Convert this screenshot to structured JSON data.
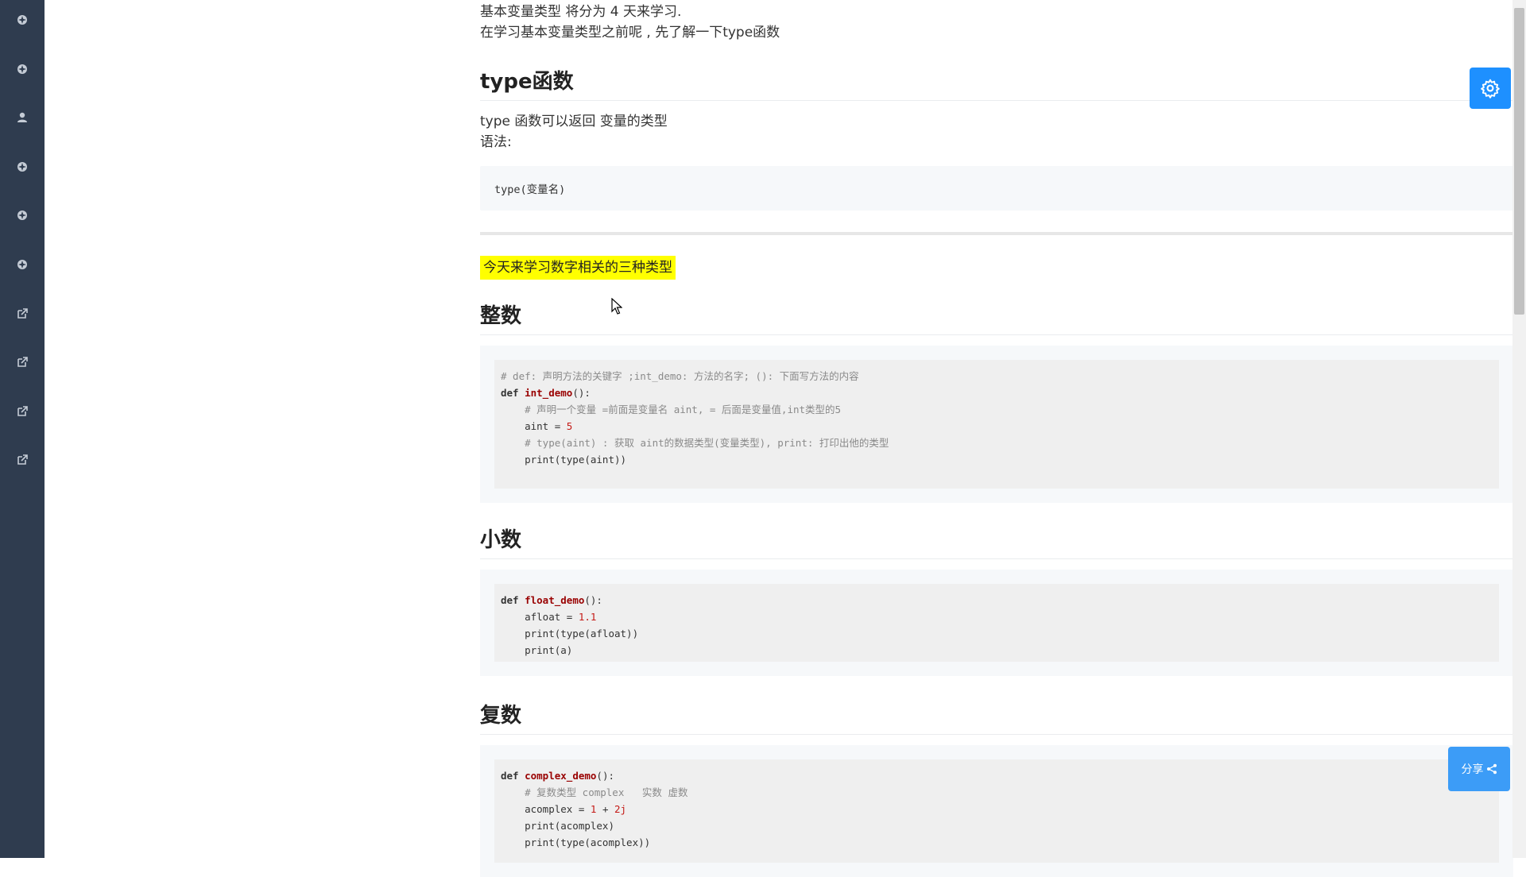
{
  "sidebar": {
    "items": [
      {
        "icon": "gear-icon"
      },
      {
        "icon": "gear-icon"
      },
      {
        "icon": "user-icon"
      },
      {
        "icon": "gear-icon"
      },
      {
        "icon": "gear-icon"
      },
      {
        "icon": "gear-icon"
      },
      {
        "icon": "external-link-icon"
      },
      {
        "icon": "external-link-icon"
      },
      {
        "icon": "external-link-icon"
      },
      {
        "icon": "external-link-icon"
      }
    ]
  },
  "article": {
    "intro_line1": "基本变量类型 将分为 4 天来学习.",
    "intro_line2": "在学习基本变量类型之前呢 , 先了解一下type函数",
    "type_heading": "type函数",
    "type_desc1": "type 函数可以返回 变量的类型",
    "type_desc2": "语法:",
    "type_syntax": "type(变量名)",
    "highlight": "今天来学习数字相关的三种类型",
    "int_heading": "整数",
    "float_heading": "小数",
    "complex_heading": "复数",
    "int_code": {
      "l1": "# def: 声明方法的关键字 ;int_demo: 方法的名字; (): 下面写方法的内容",
      "l2_kw": "def ",
      "l2_fn": "int_demo",
      "l2_rest": "():",
      "l3": "    # 声明一个变量 =前面是变量名 aint, = 后面是变量值,int类型的5",
      "l4_a": "    aint = ",
      "l4_n": "5",
      "l5": "    # type(aint) : 获取 aint的数据类型(变量类型), print: 打印出他的类型",
      "l6": "    print(type(aint))"
    },
    "float_code": {
      "l1_kw": "def ",
      "l1_fn": "float_demo",
      "l1_rest": "():",
      "l2_a": "    afloat = ",
      "l2_n": "1.1",
      "l3": "    print(type(afloat))",
      "l4": "    print(a)"
    },
    "complex_code": {
      "l1_kw": "def ",
      "l1_fn": "complex_demo",
      "l1_rest": "():",
      "l2": "    # 复数类型 complex   实数 虚数",
      "l3_a": "    acomplex = ",
      "l3_n1": "1",
      "l3_op": " + ",
      "l3_n2": "2j",
      "l4": "    print(acomplex)",
      "l5": "    print(type(acomplex))"
    }
  },
  "floating": {
    "settings_icon": "gear-icon",
    "share_label": "分享",
    "share_icon": "share-icon"
  },
  "colors": {
    "sidebar_bg": "#2f3c4f",
    "accent": "#1e90ff",
    "highlight": "#ffff00"
  }
}
